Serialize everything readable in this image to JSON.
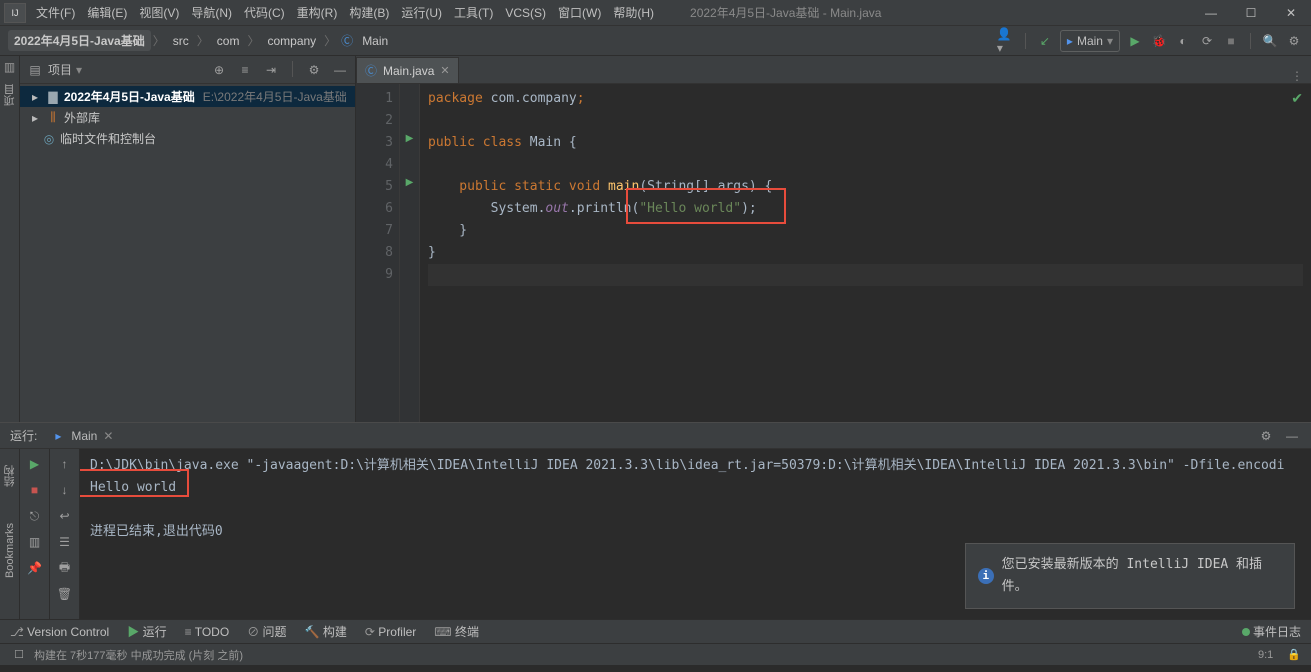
{
  "window_title": "2022年4月5日-Java基础 - Main.java",
  "menu": [
    "文件(F)",
    "编辑(E)",
    "视图(V)",
    "导航(N)",
    "代码(C)",
    "重构(R)",
    "构建(B)",
    "运行(U)",
    "工具(T)",
    "VCS(S)",
    "窗口(W)",
    "帮助(H)"
  ],
  "breadcrumbs": {
    "project": "2022年4月5日-Java基础",
    "parts": [
      "src",
      "com",
      "company"
    ],
    "last": "Main"
  },
  "run_config": "Main",
  "project_panel": {
    "title": "项目",
    "root": {
      "name": "2022年4月5日-Java基础",
      "path": "E:\\2022年4月5日-Java基础"
    },
    "ext_lib": "外部库",
    "scratch": "临时文件和控制台"
  },
  "left_rail": {
    "project": "项目"
  },
  "tab": {
    "name": "Main.java"
  },
  "code": {
    "l1_pre": "package ",
    "l1_pkg": "com.company",
    "l1_end": ";",
    "l3_pre": "public class ",
    "l3_cls": "Main ",
    "l3_end": "{",
    "l5_pre": "    public static void ",
    "l5_fn": "main",
    "l5_post": "(String[] args) {",
    "l6_pre": "        System.",
    "l6_field": "out",
    "l6_mid": ".println(",
    "l6_str": "\"Hello world\"",
    "l6_end": ");",
    "l7": "    }",
    "l8": "}"
  },
  "run": {
    "label": "运行:",
    "tab": "Main",
    "cmd": "D:\\JDK\\bin\\java.exe \"-javaagent:D:\\计算机相关\\IDEA\\IntelliJ IDEA 2021.3.3\\lib\\idea_rt.jar=50379:D:\\计算机相关\\IDEA\\IntelliJ IDEA 2021.3.3\\bin\" -Dfile.encodi",
    "out": "Hello world",
    "exit": "进程已结束,退出代码0"
  },
  "left_vtabs": {
    "structure": "结构",
    "bookmarks": "Bookmarks"
  },
  "notification": "您已安装最新版本的 IntelliJ IDEA 和插件。",
  "bottom_tabs": {
    "vcs": "Version Control",
    "run": "运行",
    "todo": "TODO",
    "problems": "问题",
    "build": "构建",
    "profiler": "Profiler",
    "terminal": "终端"
  },
  "event_log": "事件日志",
  "status": {
    "build": "构建在 7秒177毫秒 中成功完成 (片刻 之前)",
    "pos": "9:1",
    "lock": "🔒"
  }
}
